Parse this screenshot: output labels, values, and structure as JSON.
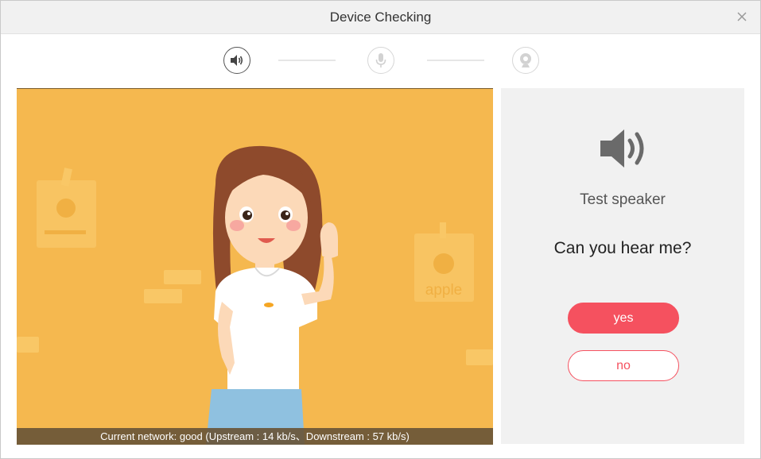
{
  "window": {
    "title": "Device Checking"
  },
  "steps": [
    {
      "name": "speaker-step",
      "icon": "speaker-icon",
      "state": "active"
    },
    {
      "name": "microphone-step",
      "icon": "microphone-icon",
      "state": "inactive"
    },
    {
      "name": "camera-step",
      "icon": "camera-icon",
      "state": "inactive"
    }
  ],
  "stage": {
    "illustration": "waving-girl-illustration",
    "poster_text": "apple",
    "network_status": "Current network: good  (Upstream : 14 kb/s、Downstream : 57 kb/s)"
  },
  "panel": {
    "icon": "speaker-icon",
    "test_label": "Test speaker",
    "question": "Can you hear me?",
    "yes_label": "yes",
    "no_label": "no"
  },
  "colors": {
    "accent": "#f5515f",
    "stage_background": "#f5b84f",
    "panel_background": "#f1f1f1"
  }
}
